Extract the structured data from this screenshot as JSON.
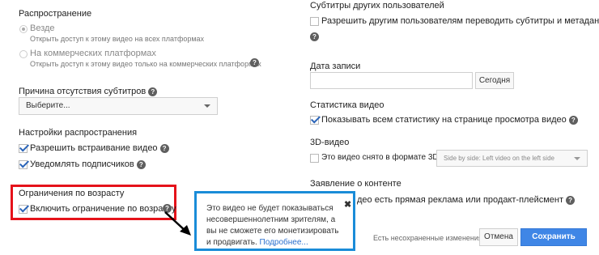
{
  "left": {
    "distribution": {
      "heading": "Распространение",
      "opt_everywhere": "Везде",
      "opt_everywhere_sub": "Открыть доступ к этому видео на всех платформах",
      "opt_commercial": "На коммерческих платформах",
      "opt_commercial_sub": "Открыть доступ к этому видео только на коммерческих платформах"
    },
    "no_subtitles": {
      "heading": "Причина отсутствия субтитров",
      "select_value": "Выберите..."
    },
    "dist_settings": {
      "heading": "Настройки распространения",
      "embed_label": "Разрешить встраивание видео",
      "notify_label": "Уведомлять подписчиков"
    },
    "age": {
      "heading": "Ограничения по возрасту",
      "enable_label": "Включить ограничение по возрасту"
    }
  },
  "tooltip": {
    "text": "Это видео не будет показываться несовершеннолетним зрителям, а вы не сможете его монетизировать и продвигать.",
    "link": "Подробнее...",
    "close_glyph": "✖"
  },
  "right": {
    "subtitles": {
      "heading": "Субтитры других пользователей",
      "allow_label": "Разрешить другим пользователям переводить субтитры и метаданные."
    },
    "record_date": {
      "heading": "Дата записи",
      "today_button": "Сегодня"
    },
    "stats": {
      "heading": "Статистика видео",
      "show_label": "Показывать всем статистику на странице просмотра видео"
    },
    "three_d": {
      "heading": "3D-видео",
      "label": "Это видео снято в формате 3D",
      "select_value": "Side by side: Left video on the left side"
    },
    "content": {
      "heading": "Заявление о контенте",
      "label_partial": "део есть прямая реклама или продакт-плейсмент"
    }
  },
  "footer": {
    "unsaved": "Есть несохраненные изменения.",
    "cancel": "Отмена",
    "save": "Сохранить"
  },
  "colors": {
    "annotation_red": "#e5121a",
    "annotation_blue": "#1a8cd8",
    "primary_button": "#3f86e6"
  }
}
